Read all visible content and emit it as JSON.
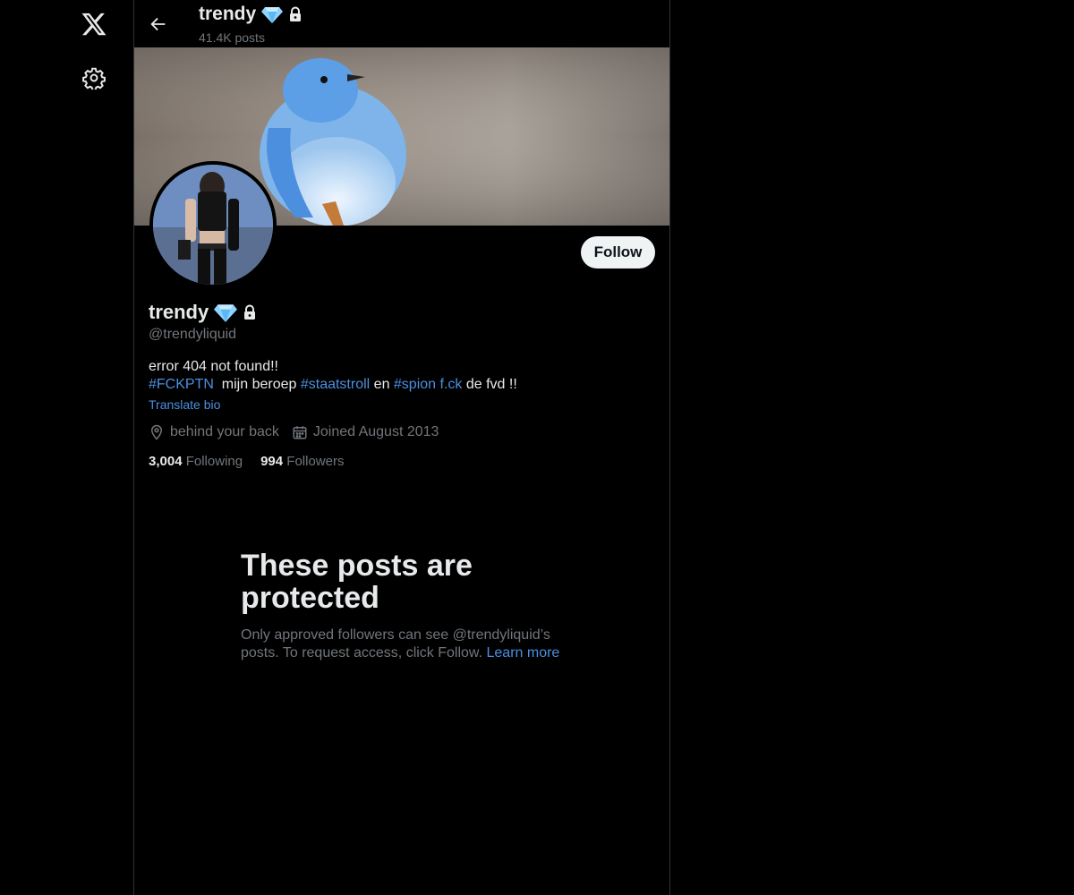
{
  "header": {
    "title": "trendy",
    "posts_count": "41.4K posts"
  },
  "profile": {
    "name": "trendy",
    "handle": "@trendyliquid",
    "bio_line1": "error 404  not found!!",
    "bio_tag1": "#FCKPTN",
    "bio_text1": "  mijn beroep ",
    "bio_tag2": "#staatstroll",
    "bio_text2": " en ",
    "bio_tag3": "#spion f.ck",
    "bio_text3": " de fvd !!",
    "translate_label": "Translate bio",
    "location": "behind your back",
    "joined": "Joined August 2013",
    "following_count": "3,004",
    "following_label": "Following",
    "followers_count": "994",
    "followers_label": "Followers",
    "follow_label": "Follow"
  },
  "protected": {
    "heading": "These posts are protected",
    "body": "Only approved followers can see @trendyliquid’s posts. To request access, click Follow.",
    "learn_more": "Learn more"
  },
  "icons": {
    "logo": "x-logo-icon",
    "settings": "gear-icon",
    "back": "back-arrow-icon",
    "badge": "diamond-icon",
    "lock": "lock-icon",
    "location": "location-pin-icon",
    "calendar": "calendar-icon"
  },
  "colors": {
    "accent": "#4b8fe0",
    "muted": "#71767b",
    "text": "#e7e9ea",
    "background": "#000000"
  }
}
